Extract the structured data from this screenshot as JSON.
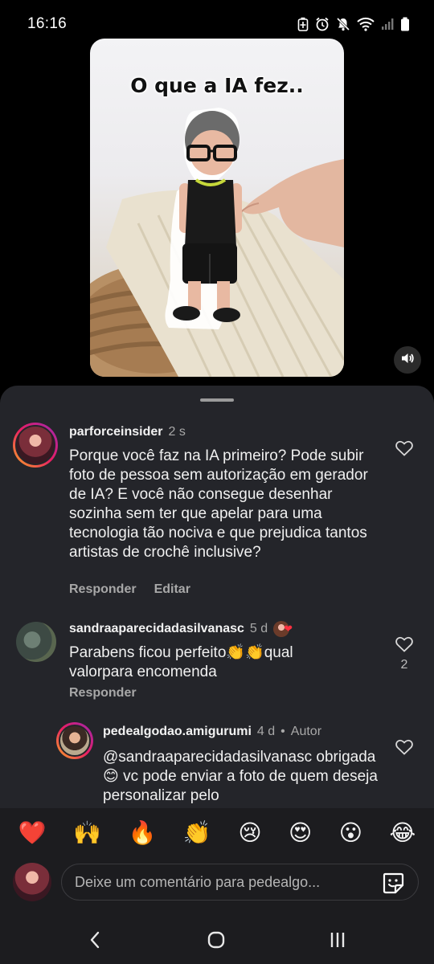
{
  "status_bar": {
    "time": "16:16",
    "icons": [
      "battery-saver-icon",
      "alarm-icon",
      "mute-icon",
      "wifi-icon",
      "signal-icon",
      "battery-icon"
    ]
  },
  "video": {
    "caption": "O que a IA fez..",
    "volume_icon": "volume-icon"
  },
  "comments": [
    {
      "username": "parforceinsider",
      "time": "2 s",
      "text": "Porque você faz na IA primeiro? Pode subir foto de pessoa sem autorização em gerador de IA? E você não consegue desenhar sozinha sem ter que apelar para uma tecnologia tão nociva e que prejudica tantos artistas de crochê inclusive?",
      "reply_label": "Responder",
      "edit_label": "Editar"
    },
    {
      "username": "sandraaparecidadasilvanasc",
      "time": "5 d",
      "text": "Parabens ficou perfeito👏👏qual valorpara encomenda",
      "reply_label": "Responder",
      "like_count": "2"
    },
    {
      "username": "pedealgodao.amigurumi",
      "time": "4 d",
      "author_label": "Autor",
      "text": "@sandraaparecidadasilvanasc obrigada 😊 vc pode enviar a foto de quem deseja personalizar pelo"
    }
  ],
  "emoji_bar": [
    "❤️",
    "🙌",
    "🔥",
    "👏",
    "😢",
    "😍",
    "😮",
    "😂"
  ],
  "input": {
    "placeholder": "Deixe um comentário para pedealgo..."
  },
  "nav": {
    "icons": [
      "back-icon",
      "home-icon",
      "recent-apps-icon"
    ]
  }
}
